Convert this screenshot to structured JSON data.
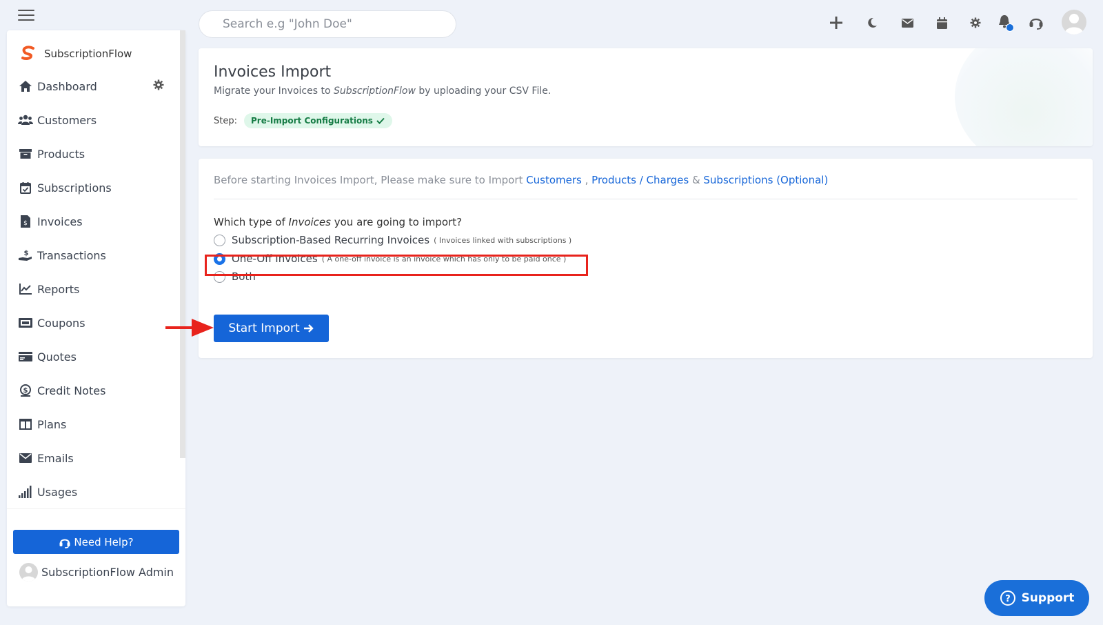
{
  "app": {
    "brand": "SubscriptionFlow"
  },
  "search": {
    "placeholder": "Search e.g \"John Doe\""
  },
  "sidebar": {
    "items": [
      {
        "label": "Dashboard",
        "icon": "home-icon"
      },
      {
        "label": "Customers",
        "icon": "users-icon"
      },
      {
        "label": "Products",
        "icon": "box-icon"
      },
      {
        "label": "Subscriptions",
        "icon": "calendar-check-icon"
      },
      {
        "label": "Invoices",
        "icon": "invoice-icon"
      },
      {
        "label": "Transactions",
        "icon": "hand-dollar-icon"
      },
      {
        "label": "Reports",
        "icon": "chart-line-icon"
      },
      {
        "label": "Coupons",
        "icon": "ticket-icon"
      },
      {
        "label": "Quotes",
        "icon": "quote-card-icon"
      },
      {
        "label": "Credit Notes",
        "icon": "dollar-circle-icon"
      },
      {
        "label": "Plans",
        "icon": "columns-icon"
      },
      {
        "label": "Emails",
        "icon": "envelope-icon"
      },
      {
        "label": "Usages",
        "icon": "signal-bars-icon"
      }
    ],
    "need_help": "Need Help?",
    "admin_name": "SubscriptionFlow Admin"
  },
  "page": {
    "title": "Invoices Import",
    "subtitle_prefix": "Migrate your Invoices to ",
    "subtitle_brand": "SubscriptionFlow",
    "subtitle_suffix": " by uploading your CSV File.",
    "step_label": "Step:",
    "step_value": "Pre-Import Configurations"
  },
  "notice": {
    "prefix": "Before starting Invoices Import, Please make sure to Import ",
    "link_customers": "Customers",
    "sep1": " , ",
    "link_products": "Products / Charges",
    "sep2": " & ",
    "link_subscriptions": "Subscriptions (Optional)"
  },
  "question": {
    "prefix": "Which type of ",
    "emph": "Invoices",
    "suffix": " you are going to import?"
  },
  "options": [
    {
      "label": "Subscription-Based Recurring Invoices",
      "hint": "( Invoices linked with subscriptions )",
      "checked": false
    },
    {
      "label": "One-Off Invoices",
      "hint": "( A one-off invoice is an invoice which has only to be paid once )",
      "checked": true
    },
    {
      "label": "Both",
      "hint": "",
      "checked": false
    }
  ],
  "start_button": "Start Import",
  "support": "Support",
  "colors": {
    "primary": "#1565d8",
    "highlight": "#e8231c",
    "badge_bg": "#dff7ea",
    "badge_text": "#167c45"
  }
}
